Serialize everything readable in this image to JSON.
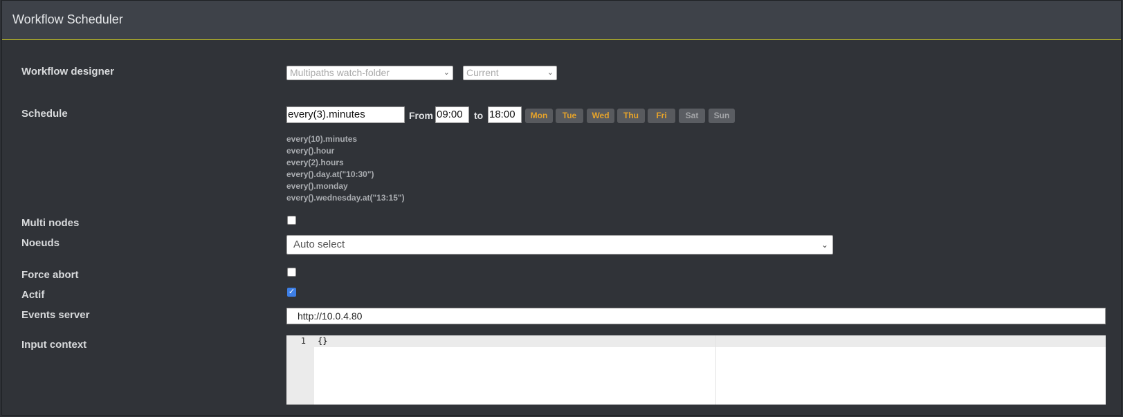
{
  "header": {
    "title": "Workflow Scheduler"
  },
  "form": {
    "workflow_designer": {
      "label": "Workflow designer",
      "workflow_value": "Multipaths watch-folder",
      "version_value": "Current"
    },
    "schedule": {
      "label": "Schedule",
      "expression": "every(3).minutes",
      "from_label": "From",
      "from_value": "09:00",
      "to_label": "to",
      "to_value": "18:00",
      "days": [
        {
          "label": "Mon",
          "active": true
        },
        {
          "label": "Tue",
          "active": true
        },
        {
          "label": "Wed",
          "active": true
        },
        {
          "label": "Thu",
          "active": true
        },
        {
          "label": "Fri",
          "active": true
        },
        {
          "label": "Sat",
          "active": false
        },
        {
          "label": "Sun",
          "active": false
        }
      ],
      "examples": [
        "every(10).minutes",
        "every().hour",
        "every(2).hours",
        "every().day.at(\"10:30\")",
        "every().monday",
        "every().wednesday.at(\"13:15\")"
      ]
    },
    "multi_nodes": {
      "label": "Multi nodes",
      "checked": false
    },
    "noeuds": {
      "label": "Noeuds",
      "value": "Auto select"
    },
    "force_abort": {
      "label": "Force abort",
      "checked": false
    },
    "actif": {
      "label": "Actif",
      "checked": true
    },
    "events_server": {
      "label": "Events server",
      "value": "http://10.0.4.80"
    },
    "input_context": {
      "label": "Input context",
      "line_number": "1",
      "code": "{}"
    }
  },
  "colors": {
    "accent_line": "#d4d21f",
    "day_active_text": "#e6a32a",
    "checkbox_checked": "#3d7fe6"
  },
  "icons": {
    "select_chevron": "chevron-down-icon",
    "checkbox_check": "check-icon"
  }
}
